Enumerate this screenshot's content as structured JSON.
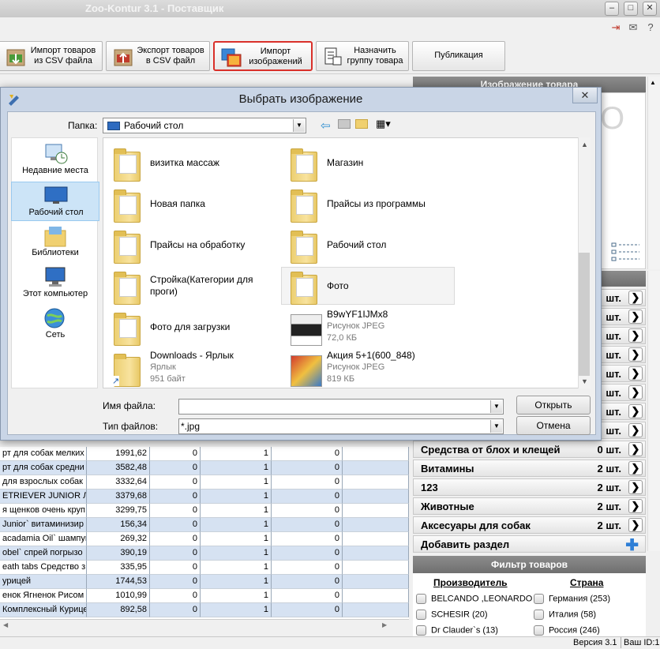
{
  "app": {
    "title": "Zoo-Kontur 3.1 - Поставщик"
  },
  "toolbar": {
    "import_csv": "Импорт товаров из CSV файла",
    "export_csv": "Экспорт товаров в CSV файл",
    "import_images": "Импорт изображений",
    "assign_group": "Назначить группу товара",
    "publish": "Публикация"
  },
  "right_panel": {
    "image_header": "Изображение товара",
    "categories": [
      {
        "name": "",
        "count": "шт."
      },
      {
        "name": "",
        "count": "шт."
      },
      {
        "name": "",
        "count": "шт."
      },
      {
        "name": "",
        "count": "шт."
      },
      {
        "name": "",
        "count": "шт."
      },
      {
        "name": "",
        "count": "шт."
      },
      {
        "name": "",
        "count": "шт."
      },
      {
        "name": "",
        "count": "шт."
      },
      {
        "name": "Средства от блох и клещей",
        "count": "0 шт."
      },
      {
        "name": "Витамины",
        "count": "2 шт."
      },
      {
        "name": "123",
        "count": "2 шт."
      },
      {
        "name": "Животные",
        "count": "2 шт."
      },
      {
        "name": "Аксесуары для собак",
        "count": "2 шт."
      }
    ],
    "add_section": "Добавить раздел",
    "filter_header": "Фильтр товаров",
    "manufacturer_header": "Производитель",
    "country_header": "Страна",
    "manufacturers": [
      "BELCANDO ,LEONARDO (",
      "SCHESIR (20)",
      "Dr Clauder`s (13)"
    ],
    "countries": [
      "Германия (253)",
      "Италия (58)",
      "Россия (246)"
    ]
  },
  "grid": {
    "rows": [
      {
        "name": "рт для собак мелких",
        "price": "1991,62",
        "c1": "0",
        "c2": "1",
        "c3": "0",
        "hl": false
      },
      {
        "name": "рт для собак средни",
        "price": "3582,48",
        "c1": "0",
        "c2": "1",
        "c3": "0",
        "hl": true
      },
      {
        "name": "для взрослых собак",
        "price": "3332,64",
        "c1": "0",
        "c2": "1",
        "c3": "0",
        "hl": false
      },
      {
        "name": "ETRIEVER JUNIOR Л",
        "price": "3379,68",
        "c1": "0",
        "c2": "1",
        "c3": "0",
        "hl": true
      },
      {
        "name": "я щенков очень круп",
        "price": "3299,75",
        "c1": "0",
        "c2": "1",
        "c3": "0",
        "hl": false
      },
      {
        "name": "Junior` витаминизир",
        "price": "156,34",
        "c1": "0",
        "c2": "1",
        "c3": "0",
        "hl": true
      },
      {
        "name": "acadamia Oil` шампун",
        "price": "269,32",
        "c1": "0",
        "c2": "1",
        "c3": "0",
        "hl": false
      },
      {
        "name": "obel` спрей погрызо",
        "price": "390,19",
        "c1": "0",
        "c2": "1",
        "c3": "0",
        "hl": true
      },
      {
        "name": "eath tabs Средство з",
        "price": "335,95",
        "c1": "0",
        "c2": "1",
        "c3": "0",
        "hl": false
      },
      {
        "name": "урицей",
        "price": "1744,53",
        "c1": "0",
        "c2": "1",
        "c3": "0",
        "hl": true
      },
      {
        "name": "енок Ягненок Рисом",
        "price": "1010,99",
        "c1": "0",
        "c2": "1",
        "c3": "0",
        "hl": false
      },
      {
        "name": "Комплексный Курице",
        "price": "892,58",
        "c1": "0",
        "c2": "1",
        "c3": "0",
        "hl": true
      }
    ]
  },
  "status": {
    "version": "Версия 3.1",
    "user": "Ваш ID:1"
  },
  "dialog": {
    "title": "Выбрать изображение",
    "folder_label": "Папка:",
    "folder_value": "Рабочий стол",
    "places": [
      "Недавние места",
      "Рабочий стол",
      "Библиотеки",
      "Этот компьютер",
      "Сеть"
    ],
    "files": [
      {
        "name": "визитка массаж",
        "sub1": "",
        "sub2": "",
        "kind": "folder"
      },
      {
        "name": "Магазин",
        "sub1": "",
        "sub2": "",
        "kind": "folder"
      },
      {
        "name": "Новая папка",
        "sub1": "",
        "sub2": "",
        "kind": "folder"
      },
      {
        "name": "Прайсы из программы",
        "sub1": "",
        "sub2": "",
        "kind": "folder"
      },
      {
        "name": "Прайсы на обработку",
        "sub1": "",
        "sub2": "",
        "kind": "folder"
      },
      {
        "name": "Рабочий стол",
        "sub1": "",
        "sub2": "",
        "kind": "folder"
      },
      {
        "name": "Стройка(Категории для проги)",
        "sub1": "",
        "sub2": "",
        "kind": "folder"
      },
      {
        "name": "Фото",
        "sub1": "",
        "sub2": "",
        "kind": "folder"
      },
      {
        "name": "Фото для загрузки",
        "sub1": "",
        "sub2": "",
        "kind": "folder"
      },
      {
        "name": "B9wYF1IJMx8",
        "sub1": "Рисунок JPEG",
        "sub2": "72,0 КБ",
        "kind": "jpg1"
      },
      {
        "name": "Downloads - Ярлык",
        "sub1": "Ярлык",
        "sub2": "951 байт",
        "kind": "shortcut"
      },
      {
        "name": "Акция 5+1(600_848)",
        "sub1": "Рисунок JPEG",
        "sub2": "819 КБ",
        "kind": "jpg2"
      }
    ],
    "filename_label": "Имя файла:",
    "filename_value": "",
    "filetype_label": "Тип файлов:",
    "filetype_value": "*.jpg",
    "open_button": "Открыть",
    "cancel_button": "Отмена"
  }
}
